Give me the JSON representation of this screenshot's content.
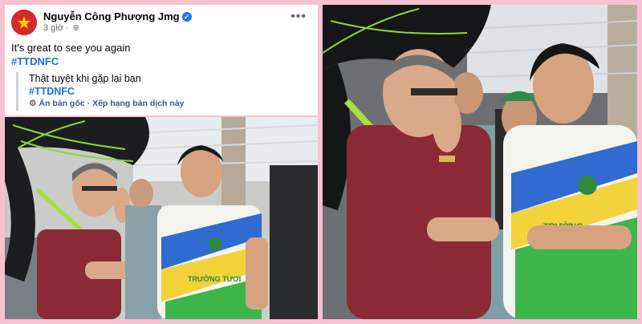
{
  "post": {
    "author": "Nguyễn Công Phượng Jmg",
    "time": "3 giờ",
    "separator": "·",
    "caption": "It's great to see you again",
    "hashtag": "#TTDNFC",
    "translation": {
      "text": "Thật tuyệt khi gặp lại bạn",
      "hashtag": "#TTDNFC",
      "see_original": "Ẩn bản gốc",
      "rate_translation": "Xếp hạng bản dịch này"
    }
  },
  "icons": {
    "avatar_flag": "vietnam-flag-icon",
    "verified": "verified-badge-icon",
    "privacy": "globe-icon",
    "more": "more-options-icon",
    "settings": "gear-icon"
  },
  "photos": {
    "left_description_visible_text": "TRƯỜNG TƯƠI",
    "right_description_visible_text": "TRƯỜNG"
  },
  "colors": {
    "frame": "#f7c2cf",
    "link": "#216fdb",
    "verified": "#1877f2",
    "shirt_maroon": "#8b2a35",
    "umbrella_green": "#a8e03a"
  }
}
